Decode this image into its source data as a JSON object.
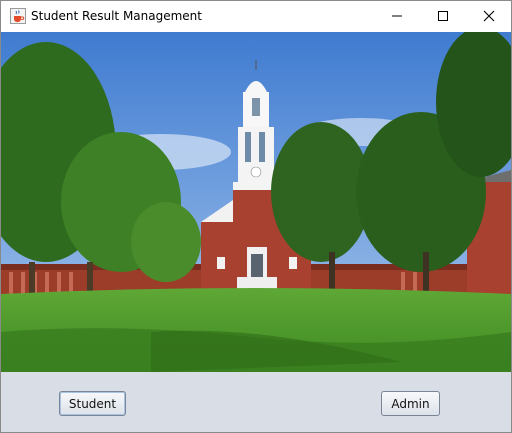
{
  "window": {
    "title": "Student Result Management",
    "icon": "java-cup-icon",
    "controls": [
      "minimize-icon",
      "maximize-icon",
      "close-icon"
    ]
  },
  "scene": {
    "description_icon": "college-campus-image"
  },
  "buttons": {
    "student_label": "Student",
    "admin_label": "Admin"
  },
  "colors": {
    "panel_bg": "#d9dde5",
    "sky": "#5b8fd6",
    "grass": "#4f9a2e",
    "brick": "#a8412f"
  }
}
